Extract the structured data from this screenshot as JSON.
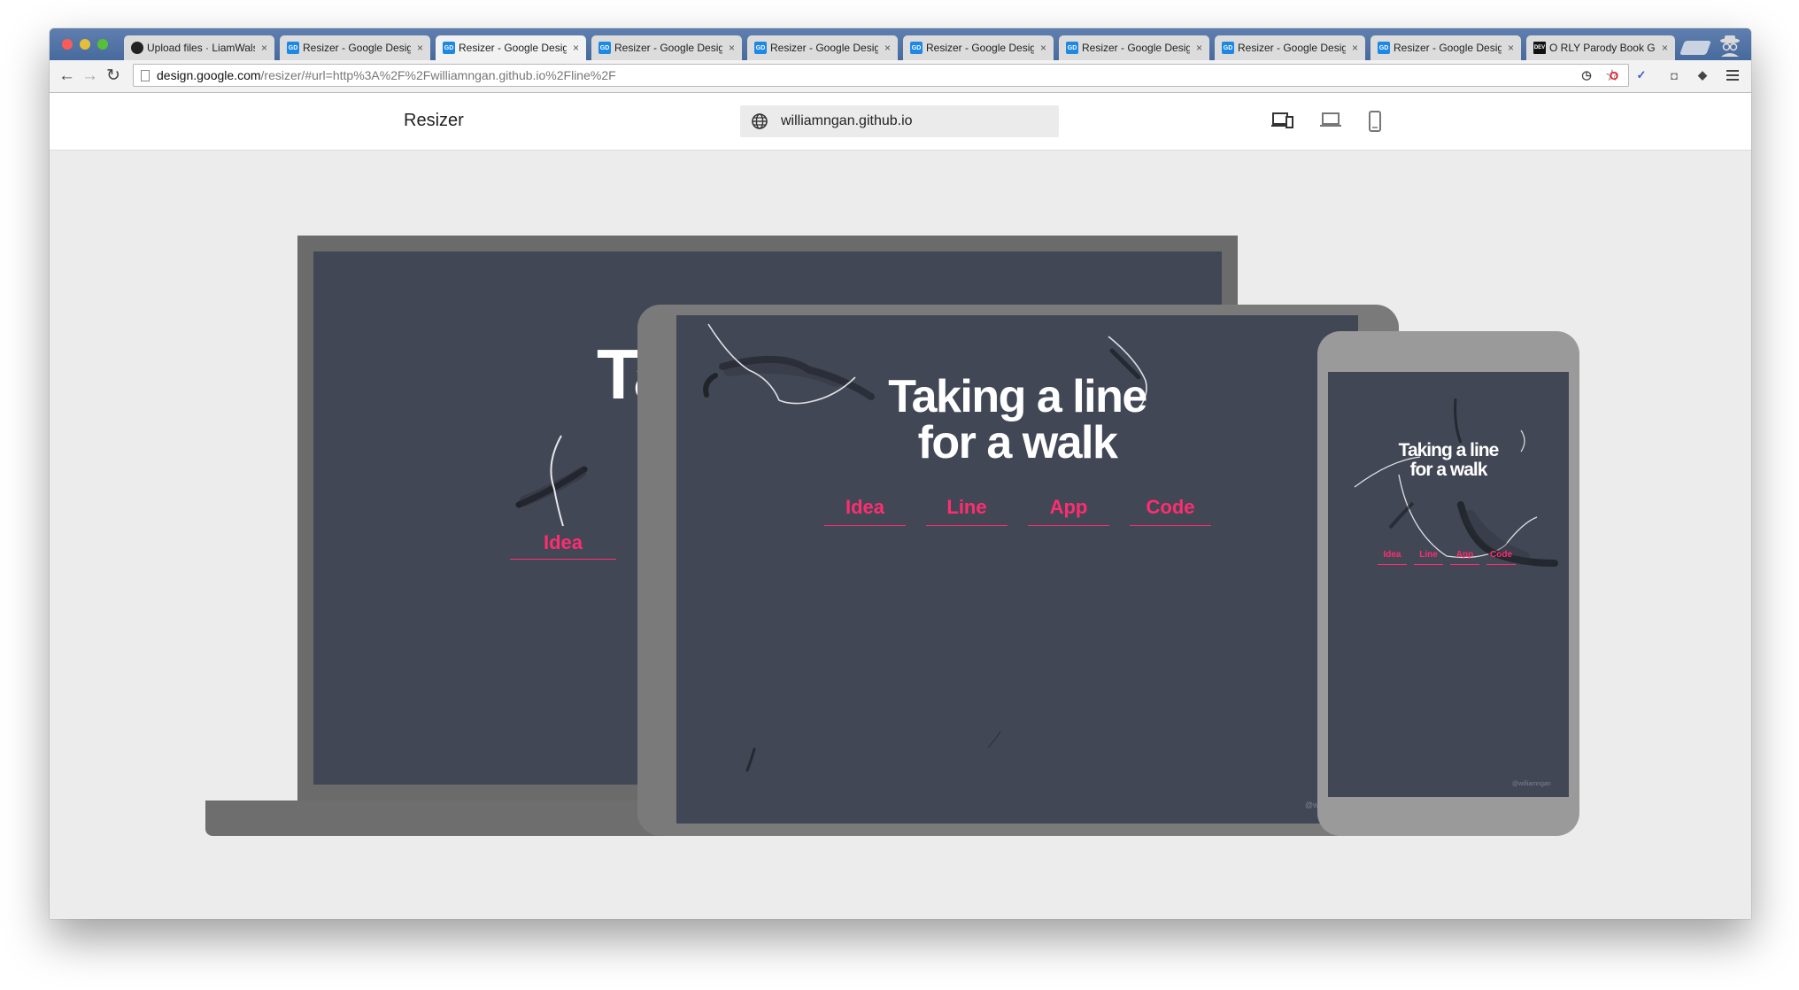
{
  "browser": {
    "tabs": [
      {
        "title": "Upload files · LiamWalsh",
        "favicon": "github-icon",
        "active": false
      },
      {
        "title": "Resizer - Google Design",
        "favicon": "gd-icon",
        "active": false
      },
      {
        "title": "Resizer - Google Design",
        "favicon": "gd-icon",
        "active": true
      },
      {
        "title": "Resizer - Google Design",
        "favicon": "gd-icon",
        "active": false
      },
      {
        "title": "Resizer - Google Design",
        "favicon": "gd-icon",
        "active": false
      },
      {
        "title": "Resizer - Google Design",
        "favicon": "gd-icon",
        "active": false
      },
      {
        "title": "Resizer - Google Design",
        "favicon": "gd-icon",
        "active": false
      },
      {
        "title": "Resizer - Google Design",
        "favicon": "gd-icon",
        "active": false
      },
      {
        "title": "Resizer - Google Design",
        "favicon": "gd-icon",
        "active": false
      },
      {
        "title": "O RLY Parody Book Generator",
        "favicon": "dev-icon",
        "active": false
      }
    ],
    "favicon_text": {
      "gd": "GD",
      "dev": "DEV"
    },
    "tab_close": "×",
    "address_host": "design.google.com",
    "address_path": "/resizer/#url=http%3A%2F%2Fwilliamngan.github.io%2Fline%2F",
    "icons": {
      "back": "←",
      "forward": "→",
      "reload": "↻",
      "star": "☆"
    },
    "extensions": [
      "history-icon",
      "opera-icon",
      "ublock-icon",
      "camera-icon",
      "incognito-icon"
    ],
    "extension_glyphs": [
      "◷",
      "O",
      "✓",
      "◘",
      "◆"
    ]
  },
  "app": {
    "title": "Resizer",
    "url_field": "williamngan.github.io",
    "modes": [
      "responsive-mode-icon",
      "desktop-mode-icon",
      "mobile-mode-icon"
    ]
  },
  "site": {
    "title": "Taking a line\nfor a walk",
    "laptop_title_fragment": "Ta",
    "links": [
      "Idea",
      "Line",
      "App",
      "Code"
    ],
    "handle": "@williamngan"
  },
  "colors": {
    "site_bg": "#424756",
    "accent": "#ff2d6f",
    "app_bg": "#ececec",
    "laptop": "#6b6b6b",
    "tablet": "#7a7a7a",
    "phone": "#9a9a9a"
  }
}
